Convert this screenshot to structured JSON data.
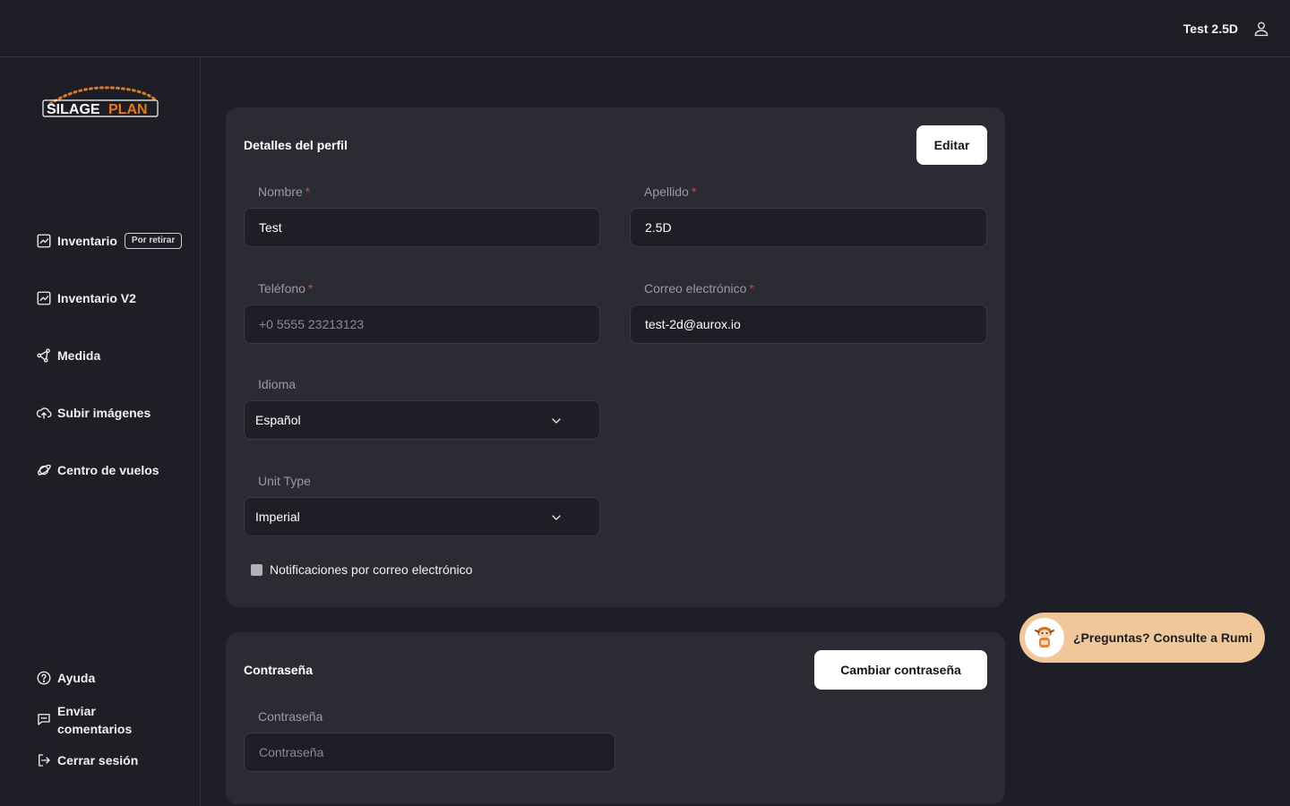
{
  "header": {
    "user_name": "Test 2.5D"
  },
  "brand": {
    "logo_text_a": "SILAGE",
    "logo_text_b": "PLAN",
    "accent": "#e07a1f"
  },
  "sidebar": {
    "items": [
      {
        "label": "Inventario",
        "badge": "Por retirar",
        "icon": "chart-icon"
      },
      {
        "label": "Inventario V2",
        "icon": "chart-icon"
      },
      {
        "label": "Medida",
        "icon": "measure-icon"
      },
      {
        "label": "Subir imágenes",
        "icon": "cloud-upload-icon"
      },
      {
        "label": "Centro de vuelos",
        "icon": "planet-icon"
      }
    ],
    "footer": [
      {
        "label": "Ayuda",
        "icon": "help-icon"
      },
      {
        "label_line1": "Enviar",
        "label_line2": "comentarios",
        "icon": "chat-icon"
      },
      {
        "label": "Cerrar sesión",
        "icon": "logout-icon"
      }
    ]
  },
  "profile": {
    "title": "Detalles del perfil",
    "edit_label": "Editar",
    "first_name": {
      "label": "Nombre",
      "required": "*",
      "value": "Test"
    },
    "last_name": {
      "label": "Apellido",
      "required": "*",
      "value": "2.5D"
    },
    "phone": {
      "label": "Teléfono",
      "required": "*",
      "placeholder": "+0 5555 23213123"
    },
    "email": {
      "label": "Correo electrónico",
      "required": "*",
      "value": "test-2d@aurox.io"
    },
    "language": {
      "label": "Idioma",
      "value": "Español"
    },
    "unit_type": {
      "label": "Unit Type",
      "value": "Imperial"
    },
    "email_notifications": {
      "label": "Notificaciones por correo electrónico",
      "checked": false
    }
  },
  "password": {
    "title": "Contraseña",
    "change_label": "Cambiar contraseña",
    "field_label": "Contraseña",
    "placeholder": "Contraseña"
  },
  "assistant": {
    "label": "¿Preguntas? Consulte a Rumi",
    "accent": "#efc79a"
  }
}
